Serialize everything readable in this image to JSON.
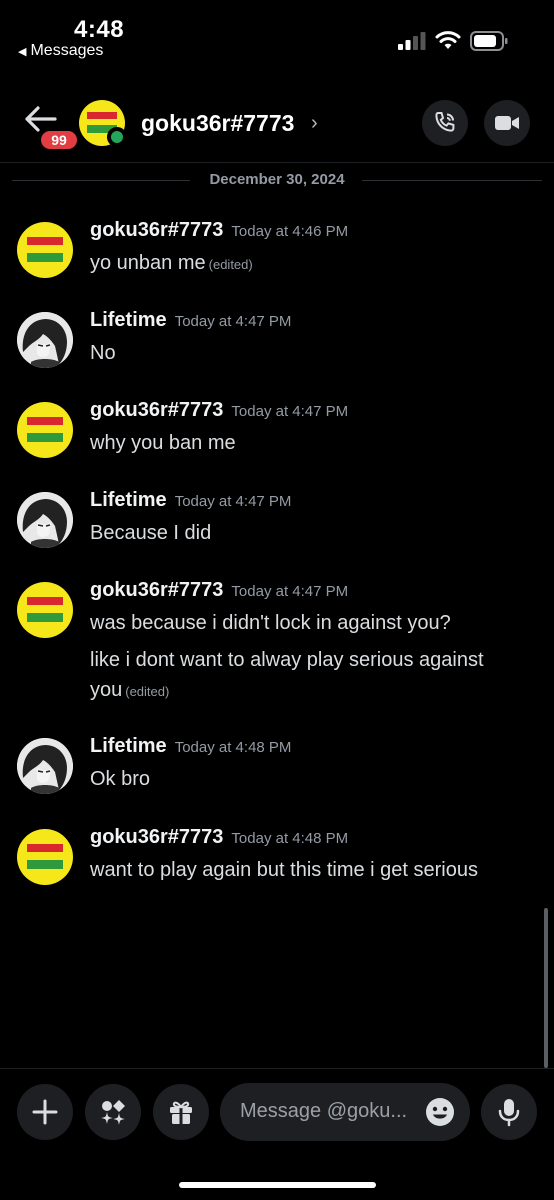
{
  "status_bar": {
    "time": "4:48",
    "back_app": "Messages"
  },
  "header": {
    "unread_badge": "99",
    "name": "goku36r#7773",
    "chevron": "›"
  },
  "date_divider": "December 30, 2024",
  "messages": [
    {
      "author": "goku36r#7773",
      "time": "Today at 4:46 PM",
      "avatar": "flag-avatar",
      "lines": [
        "yo unban me"
      ],
      "edited": "(edited)"
    },
    {
      "author": "Lifetime",
      "time": "Today at 4:47 PM",
      "avatar": "anime-avatar",
      "lines": [
        "No"
      ]
    },
    {
      "author": "goku36r#7773",
      "time": "Today at 4:47 PM",
      "avatar": "flag-avatar",
      "lines": [
        "why you ban me"
      ]
    },
    {
      "author": "Lifetime",
      "time": "Today at 4:47 PM",
      "avatar": "anime-avatar",
      "lines": [
        "Because I did"
      ]
    },
    {
      "author": "goku36r#7773",
      "time": "Today at 4:47 PM",
      "avatar": "flag-avatar",
      "lines": [
        "was because i didn't lock in against you?",
        "like i dont want to alway play serious against",
        "you"
      ],
      "edited": "(edited)"
    },
    {
      "author": "Lifetime",
      "time": "Today at 4:48 PM",
      "avatar": "anime-avatar",
      "lines": [
        "Ok bro"
      ]
    },
    {
      "author": "goku36r#7773",
      "time": "Today at 4:48 PM",
      "avatar": "flag-avatar",
      "lines": [
        "want to play again but this time i get serious"
      ]
    }
  ],
  "composer": {
    "placeholder": "Message @goku..."
  },
  "icons": {
    "back": "arrow-left-icon",
    "call": "phone-icon",
    "video": "video-camera-icon",
    "plus": "plus-icon",
    "apps": "apps-icon",
    "gift": "gift-icon",
    "emoji": "emoji-icon",
    "mic": "microphone-icon"
  },
  "colors": {
    "background": "#000000",
    "badge": "#e23d42",
    "online": "#23a55a",
    "button_bg": "#1e1f22"
  }
}
